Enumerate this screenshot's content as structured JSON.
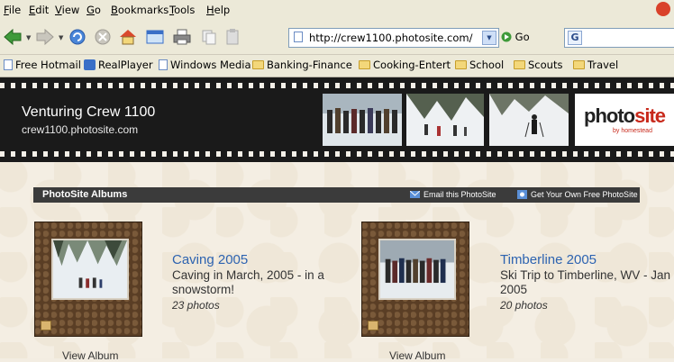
{
  "menu": [
    "File",
    "Edit",
    "View",
    "Go",
    "Bookmarks",
    "Tools",
    "Help"
  ],
  "menu_accel": [
    "F",
    "E",
    "V",
    "G",
    "B",
    "T",
    "H"
  ],
  "address": {
    "url": "http://crew1100.photosite.com/",
    "go_label": "Go"
  },
  "bookmarks": [
    "Free Hotmail",
    "RealPlayer",
    "Windows Media",
    "Banking-Finance",
    "Cooking-Entert",
    "School",
    "Scouts",
    "Travel"
  ],
  "banner": {
    "title": "Venturing Crew 1100",
    "subtitle": "crew1100.photosite.com",
    "logo_main": "photo",
    "logo_accent": "site",
    "logo_sub": "by homestead"
  },
  "albums_bar": {
    "title": "PhotoSite Albums",
    "email_link": "Email this PhotoSite",
    "get_link": "Get Your Own Free PhotoSite"
  },
  "albums": [
    {
      "title": "Caving 2005",
      "description": "Caving in March, 2005 - in a snowstorm!",
      "count": "23 photos",
      "view_label": "View Album"
    },
    {
      "title": "Timberline 2005",
      "description": "Ski Trip to Timberline, WV - Jan 2005",
      "count": "20 photos",
      "view_label": "View Album"
    }
  ],
  "colors": {
    "link_blue": "#2d63b0",
    "banner_bg": "#1a1a1a",
    "bar_bg": "#3b3b3b",
    "brand_red": "#c8291b"
  }
}
